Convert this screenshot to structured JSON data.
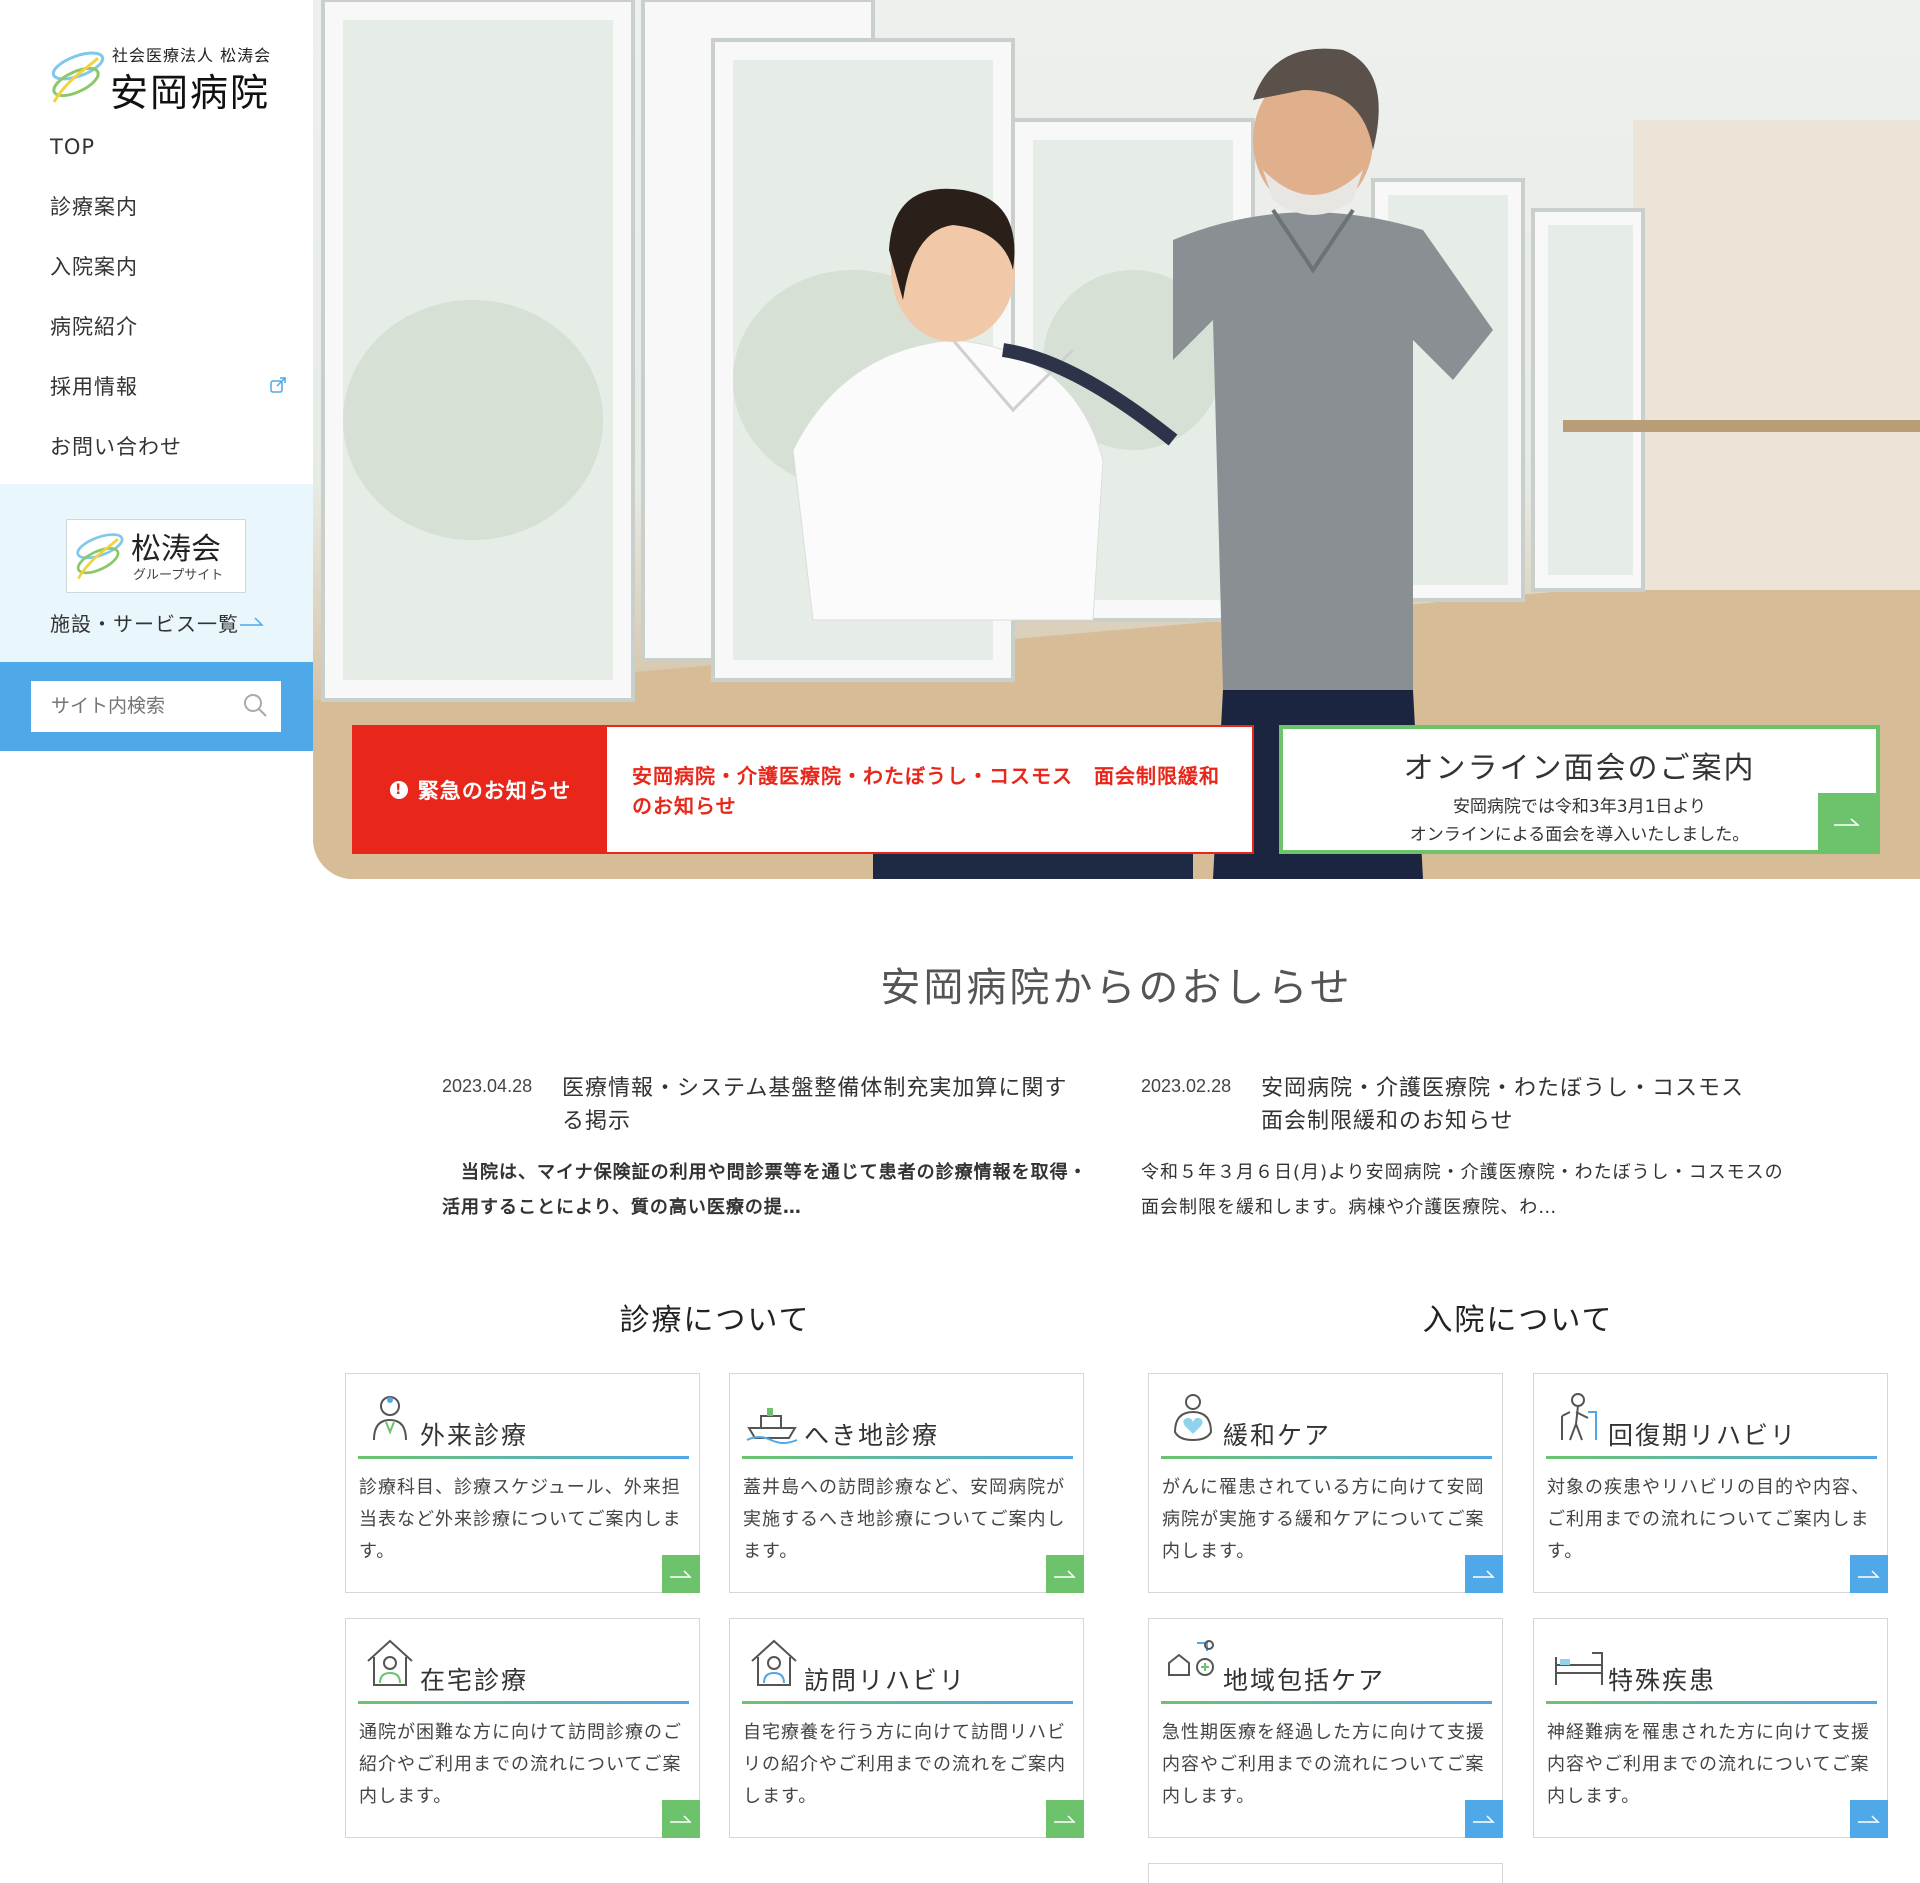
{
  "logo": {
    "subtitle": "社会医療法人 松涛会",
    "name": "安岡病院"
  },
  "nav": {
    "items": [
      {
        "label": "TOP"
      },
      {
        "label": "診療案内"
      },
      {
        "label": "入院案内"
      },
      {
        "label": "病院紹介"
      },
      {
        "label": "採用情報",
        "icon": "external-link-icon"
      },
      {
        "label": "お問い合わせ"
      }
    ]
  },
  "group_site": {
    "title": "松涛会",
    "subtitle": "グループサイト",
    "facility_link": "施設・サービス一覧"
  },
  "search": {
    "placeholder": "サイト内検索"
  },
  "urgent": {
    "label": "緊急のお知らせ",
    "text": "安岡病院・介護医療院・わたぼうし・コスモス　面会制限緩和のお知らせ"
  },
  "online": {
    "title": "オンライン面会のご案内",
    "line1": "安岡病院では令和3年3月1日より",
    "line2": "オンラインによる面会を導入いたしました。"
  },
  "news": {
    "heading": "安岡病院からのおしらせ",
    "items": [
      {
        "date": "2023.04.28",
        "title": "医療情報・システム基盤整備体制充実加算に関する掲示",
        "body": "　当院は、マイナ保険証の利用や問診票等を通じて患者の診療情報を取得・活用することにより、質の高い医療の提…"
      },
      {
        "date": "2023.02.28",
        "title": "安岡病院・介護医療院・わたぼうし・コスモス　面会制限緩和のお知らせ",
        "body": "令和５年３月６日(月)より安岡病院・介護医療院・わたぼうし・コスモスの面会制限を緩和します。病棟や介護医療院、わ…"
      }
    ]
  },
  "outpatient": {
    "heading": "診療について",
    "cards": [
      {
        "title": "外来診療",
        "icon": "doctor-icon",
        "desc": "診療科目、診療スケジュール、外来担当表など外来診療についてご案内します。"
      },
      {
        "title": "へき地診療",
        "icon": "ship-icon",
        "desc": "蓋井島への訪問診療など、安岡病院が実施するへき地診療についてご案内します。"
      },
      {
        "title": "在宅診療",
        "icon": "home-doctor-icon",
        "desc": "通院が困難な方に向けて訪問診療のご紹介やご利用までの流れについてご案内します。"
      },
      {
        "title": "訪問リハビリ",
        "icon": "home-rehab-icon",
        "desc": "自宅療養を行う方に向けて訪問リハビリの紹介やご利用までの流れをご案内します。"
      }
    ]
  },
  "inpatient": {
    "heading": "入院について",
    "cards": [
      {
        "title": "緩和ケア",
        "icon": "heart-care-icon",
        "desc": "がんに罹患されている方に向けて安岡病院が実施する緩和ケアについてご案内します。"
      },
      {
        "title": "回復期リハビリ",
        "icon": "walker-icon",
        "desc": "対象の疾患やリハビリの目的や内容、ご利用までの流れについてご案内します。"
      },
      {
        "title": "地域包括ケア",
        "icon": "community-care-icon",
        "desc": "急性期医療を経過した方に向けて支援内容やご利用までの流れについてご案内します。"
      },
      {
        "title": "特殊疾患",
        "icon": "bed-icon",
        "desc": "神経難病を罹患された方に向けて支援内容やご利用までの流れについてご案内します。"
      }
    ]
  },
  "colors": {
    "accent_green": "#6cc36c",
    "accent_blue": "#4fa8e8",
    "urgent_red": "#e8261a",
    "sidebar_light": "#e9f6fb"
  }
}
